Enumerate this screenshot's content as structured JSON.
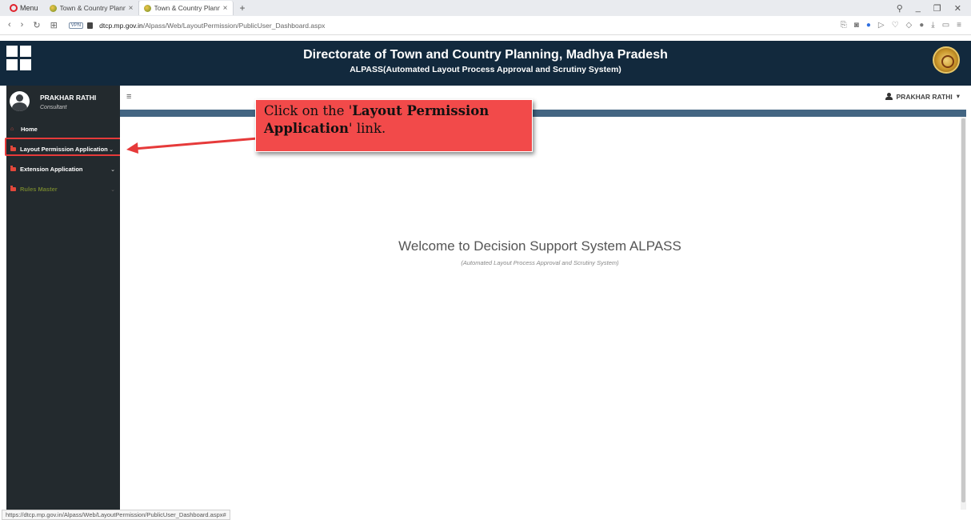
{
  "browser": {
    "menu_label": "Menu",
    "tabs": [
      {
        "title": "Town & Country Planning",
        "close": "×"
      },
      {
        "title": "Town & Country Planning",
        "close": "×"
      }
    ],
    "new_tab": "+",
    "url_host": "dtcp.mp.gov.in",
    "url_path": "/Alpass/Web/LayoutPermission/PublicUser_Dashboard.aspx",
    "vpn_badge": "VPN",
    "status_url": "https://dtcp.mp.gov.in/Alpass/Web/LayoutPermission/PublicUser_Dashboard.aspx#"
  },
  "header": {
    "title": "Directorate of Town and Country Planning, Madhya Pradesh",
    "subtitle": "ALPASS(Automated Layout Process Approval and Scrutiny System)"
  },
  "sidebar": {
    "user_name": "PRAKHAR RATHI",
    "user_role": "Consultant",
    "items": [
      {
        "label": "Home"
      },
      {
        "label": "Layout Permission Application"
      },
      {
        "label": "Extension Application"
      },
      {
        "label": "Rules Master"
      }
    ]
  },
  "topbar": {
    "user_menu_label": "PRAKHAR RATHI"
  },
  "main": {
    "welcome_title": "Welcome to Decision Support System ALPASS",
    "welcome_subtitle": "(Automated Layout Process Approval and Scrutiny System)"
  },
  "callout": {
    "prefix": "Click on the '",
    "emphasis": "Layout Permission Application",
    "suffix": "' link."
  },
  "colors": {
    "header_bg": "#12293d",
    "sidebar_bg": "#232a2e",
    "accent_red": "#e2483b",
    "callout_bg": "#f24a4a",
    "strip_blue": "#436582"
  }
}
